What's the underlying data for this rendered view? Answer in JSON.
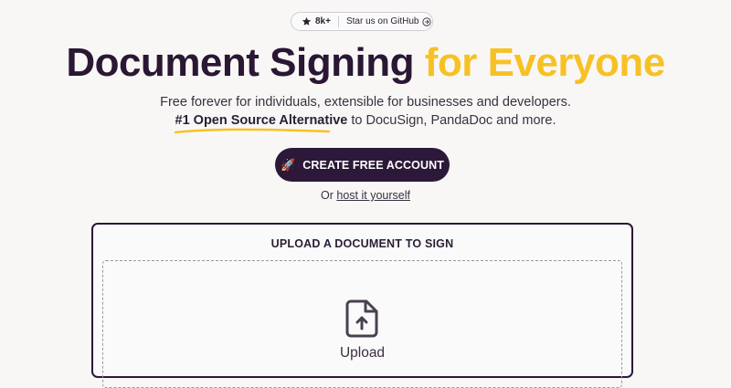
{
  "github_badge": {
    "count": "8k+",
    "label": "Star us on GitHub",
    "icon_left": "star-icon",
    "icon_right": "circle-arrow-right-icon"
  },
  "hero": {
    "title_main": "Document Signing",
    "title_accent": "for Everyone",
    "subtitle_line1": "Free forever for individuals, extensible for businesses and developers.",
    "subtitle_strong": "#1 Open Source Alternative",
    "subtitle_rest": "to DocuSign, PandaDoc and more."
  },
  "cta": {
    "icon": "🚀",
    "label": "CREATE FREE ACCOUNT"
  },
  "alt": {
    "prefix": "Or",
    "link_label": "host it yourself"
  },
  "upload": {
    "title": "UPLOAD A DOCUMENT TO SIGN",
    "icon": "file-upload-icon",
    "label": "Upload"
  },
  "colors": {
    "background": "#f9f7f6",
    "primary": "#2c1838",
    "accent": "#f8c123"
  }
}
